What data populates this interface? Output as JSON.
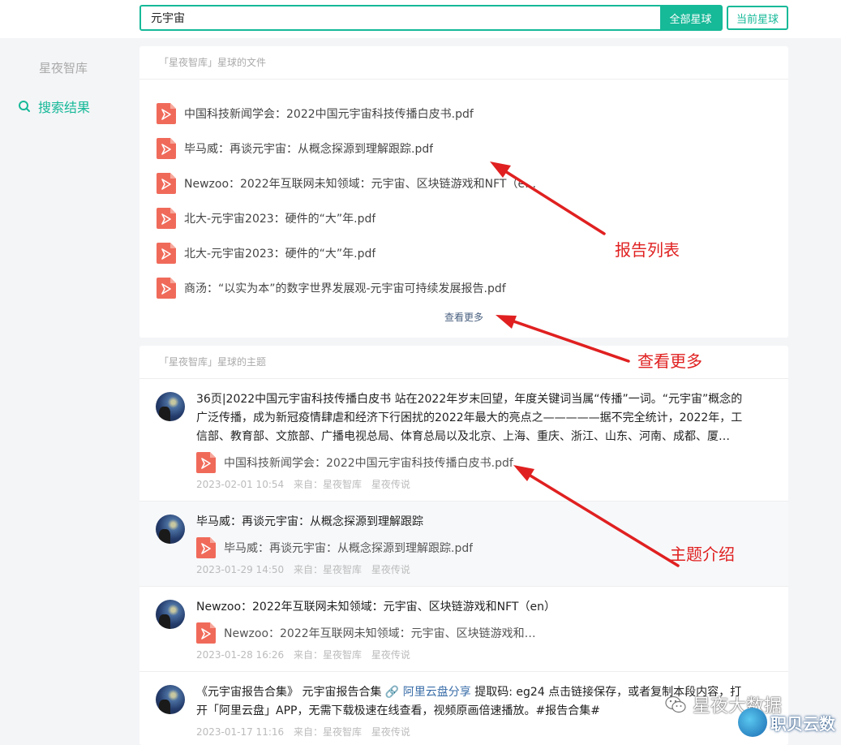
{
  "search": {
    "value": "元宇宙",
    "all_button": "全部星球",
    "current_button": "当前星球"
  },
  "sidebar": {
    "brand": "星夜智库",
    "items": [
      {
        "label": "搜索结果"
      }
    ]
  },
  "files_section": {
    "header": "「星夜智库」星球的文件",
    "files": [
      "中国科技新闻学会：2022中国元宇宙科技传播白皮书.pdf",
      "毕马威：再谈元宇宙：从概念探源到理解跟踪.pdf",
      "Newzoo：2022年互联网未知领域：元宇宙、区块链游戏和NFT（en...",
      "北大-元宇宙2023：硬件的“大”年.pdf",
      "北大-元宇宙2023：硬件的“大”年.pdf",
      "商汤：“以实为本”的数字世界发展观-元宇宙可持续发展报告.pdf"
    ],
    "more": "查看更多"
  },
  "topics_section": {
    "header": "「星夜智库」星球的主题",
    "topics": [
      {
        "text": "36页|2022中国元宇宙科技传播白皮书 站在2022年岁末回望，年度关键词当属“传播”一词。“元宇宙”概念的广泛传播，成为新冠疫情肆虐和经济下行困扰的2022年最大的亮点之—————据不完全统计，2022年，工信部、教育部、文旅部、广播电视总局、体育总局以及北京、上海、重庆、浙江、山东、河南、成都、厦门、…",
        "file": "中国科技新闻学会：2022中国元宇宙科技传播白皮书.pdf",
        "date": "2023-02-01 10:54",
        "from": "来自：星夜智库",
        "tag": "星夜传说"
      },
      {
        "text": "毕马威：再谈元宇宙：从概念探源到理解跟踪",
        "file": "毕马威：再谈元宇宙：从概念探源到理解跟踪.pdf",
        "date": "2023-01-29 14:50",
        "from": "来自：星夜智库",
        "tag": "星夜传说"
      },
      {
        "text": "Newzoo：2022年互联网未知领域：元宇宙、区块链游戏和NFT（en）",
        "file": "Newzoo：2022年互联网未知领域：元宇宙、区块链游戏和NF...",
        "date": "2023-01-28 16:26",
        "from": "来自：星夜智库",
        "tag": "星夜传说"
      },
      {
        "text_before": "《元宇宙报告合集》 元宇宙报告合集 ",
        "link": "🔗 阿里云盘分享",
        "text_after": " 提取码: eg24 点击链接保存，或者复制本段内容，打开「阿里云盘」APP，无需下载极速在线查看，视频原画倍速播放。#报告合集#",
        "date": "2023-01-17 11:16",
        "from": "来自：星夜智库",
        "tag": "星夜传说"
      }
    ]
  },
  "annotations": {
    "report_list": "报告列表",
    "see_more": "查看更多",
    "topic_intro": "主题介绍"
  },
  "watermark": {
    "text": "星夜大数据",
    "logo_text": "职贝云数"
  },
  "colors": {
    "accent": "#16b998",
    "pdf_red": "#f06a5a",
    "annotation_red": "#e02020"
  }
}
